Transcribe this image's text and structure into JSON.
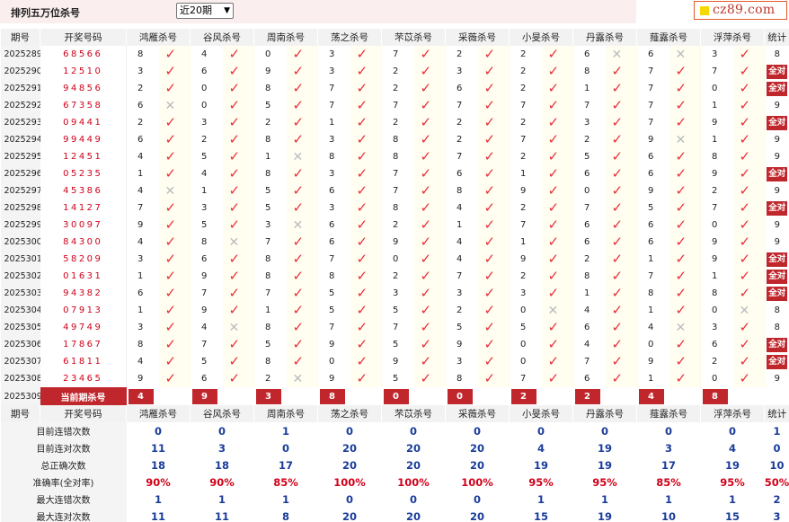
{
  "header": {
    "title": "排列五万位杀号",
    "period_select": "近20期",
    "logo": "cz89.com"
  },
  "columns": {
    "qi": "期号",
    "kj": "开奖号码",
    "experts": [
      "鸿雁杀号",
      "谷风杀号",
      "周南杀号",
      "荡之杀号",
      "芣苡杀号",
      "采薇杀号",
      "小旻杀号",
      "丹露杀号",
      "薤露杀号",
      "浮萍杀号"
    ],
    "tj": "统计"
  },
  "rows": [
    {
      "qi": "2025289",
      "kj": "68566",
      "nums": [
        "8",
        "4",
        "0",
        "3",
        "7",
        "2",
        "2",
        "6",
        "6",
        "3"
      ],
      "ok": [
        1,
        1,
        1,
        1,
        1,
        1,
        1,
        0,
        0,
        1
      ],
      "tj": "8"
    },
    {
      "qi": "2025290",
      "kj": "12510",
      "nums": [
        "3",
        "6",
        "9",
        "3",
        "2",
        "3",
        "2",
        "8",
        "7",
        "7"
      ],
      "ok": [
        1,
        1,
        1,
        1,
        1,
        1,
        1,
        1,
        1,
        1
      ],
      "tj": "全对"
    },
    {
      "qi": "2025291",
      "kj": "94856",
      "nums": [
        "2",
        "0",
        "8",
        "7",
        "2",
        "6",
        "2",
        "1",
        "7",
        "0"
      ],
      "ok": [
        1,
        1,
        1,
        1,
        1,
        1,
        1,
        1,
        1,
        1
      ],
      "tj": "全对"
    },
    {
      "qi": "2025292",
      "kj": "67358",
      "nums": [
        "6",
        "0",
        "5",
        "7",
        "7",
        "7",
        "7",
        "7",
        "7",
        "1"
      ],
      "ok": [
        0,
        1,
        1,
        1,
        1,
        1,
        1,
        1,
        1,
        1
      ],
      "tj": "9"
    },
    {
      "qi": "2025293",
      "kj": "09441",
      "nums": [
        "2",
        "3",
        "2",
        "1",
        "2",
        "2",
        "2",
        "3",
        "7",
        "9"
      ],
      "ok": [
        1,
        1,
        1,
        1,
        1,
        1,
        1,
        1,
        1,
        1
      ],
      "tj": "全对"
    },
    {
      "qi": "2025294",
      "kj": "99449",
      "nums": [
        "6",
        "2",
        "8",
        "3",
        "8",
        "2",
        "7",
        "2",
        "9",
        "1"
      ],
      "ok": [
        1,
        1,
        1,
        1,
        1,
        1,
        1,
        1,
        0,
        1
      ],
      "tj": "9"
    },
    {
      "qi": "2025295",
      "kj": "12451",
      "nums": [
        "4",
        "5",
        "1",
        "8",
        "8",
        "7",
        "2",
        "5",
        "6",
        "8"
      ],
      "ok": [
        1,
        1,
        0,
        1,
        1,
        1,
        1,
        1,
        1,
        1
      ],
      "tj": "9"
    },
    {
      "qi": "2025296",
      "kj": "05235",
      "nums": [
        "1",
        "4",
        "8",
        "3",
        "7",
        "6",
        "1",
        "6",
        "6",
        "9"
      ],
      "ok": [
        1,
        1,
        1,
        1,
        1,
        1,
        1,
        1,
        1,
        1
      ],
      "tj": "全对"
    },
    {
      "qi": "2025297",
      "kj": "45386",
      "nums": [
        "4",
        "1",
        "5",
        "6",
        "7",
        "8",
        "9",
        "0",
        "9",
        "2"
      ],
      "ok": [
        0,
        1,
        1,
        1,
        1,
        1,
        1,
        1,
        1,
        1
      ],
      "tj": "9"
    },
    {
      "qi": "2025298",
      "kj": "14127",
      "nums": [
        "7",
        "3",
        "5",
        "3",
        "8",
        "4",
        "2",
        "7",
        "5",
        "7"
      ],
      "ok": [
        1,
        1,
        1,
        1,
        1,
        1,
        1,
        1,
        1,
        1
      ],
      "tj": "全对"
    },
    {
      "qi": "2025299",
      "kj": "30097",
      "nums": [
        "9",
        "5",
        "3",
        "6",
        "2",
        "1",
        "7",
        "6",
        "6",
        "0"
      ],
      "ok": [
        1,
        1,
        0,
        1,
        1,
        1,
        1,
        1,
        1,
        1
      ],
      "tj": "9"
    },
    {
      "qi": "2025300",
      "kj": "84300",
      "nums": [
        "4",
        "8",
        "7",
        "6",
        "9",
        "4",
        "1",
        "6",
        "6",
        "9"
      ],
      "ok": [
        1,
        0,
        1,
        1,
        1,
        1,
        1,
        1,
        1,
        1
      ],
      "tj": "9"
    },
    {
      "qi": "2025301",
      "kj": "58209",
      "nums": [
        "3",
        "6",
        "8",
        "7",
        "0",
        "4",
        "9",
        "2",
        "1",
        "9"
      ],
      "ok": [
        1,
        1,
        1,
        1,
        1,
        1,
        1,
        1,
        1,
        1
      ],
      "tj": "全对"
    },
    {
      "qi": "2025302",
      "kj": "01631",
      "nums": [
        "1",
        "9",
        "8",
        "8",
        "2",
        "7",
        "2",
        "8",
        "7",
        "1"
      ],
      "ok": [
        1,
        1,
        1,
        1,
        1,
        1,
        1,
        1,
        1,
        1
      ],
      "tj": "全对"
    },
    {
      "qi": "2025303",
      "kj": "94382",
      "nums": [
        "6",
        "7",
        "7",
        "5",
        "3",
        "3",
        "3",
        "1",
        "8",
        "8"
      ],
      "ok": [
        1,
        1,
        1,
        1,
        1,
        1,
        1,
        1,
        1,
        1
      ],
      "tj": "全对"
    },
    {
      "qi": "2025304",
      "kj": "07913",
      "nums": [
        "1",
        "9",
        "1",
        "5",
        "5",
        "2",
        "0",
        "4",
        "1",
        "0"
      ],
      "ok": [
        1,
        1,
        1,
        1,
        1,
        1,
        0,
        1,
        1,
        0
      ],
      "tj": "8"
    },
    {
      "qi": "2025305",
      "kj": "49749",
      "nums": [
        "3",
        "4",
        "8",
        "7",
        "7",
        "5",
        "5",
        "6",
        "4",
        "3"
      ],
      "ok": [
        1,
        0,
        1,
        1,
        1,
        1,
        1,
        1,
        0,
        1
      ],
      "tj": "8"
    },
    {
      "qi": "2025306",
      "kj": "17867",
      "nums": [
        "8",
        "7",
        "5",
        "9",
        "5",
        "9",
        "0",
        "4",
        "0",
        "6"
      ],
      "ok": [
        1,
        1,
        1,
        1,
        1,
        1,
        1,
        1,
        1,
        1
      ],
      "tj": "全对"
    },
    {
      "qi": "2025307",
      "kj": "61811",
      "nums": [
        "4",
        "5",
        "8",
        "0",
        "9",
        "3",
        "0",
        "7",
        "9",
        "2"
      ],
      "ok": [
        1,
        1,
        1,
        1,
        1,
        1,
        1,
        1,
        1,
        1
      ],
      "tj": "全对"
    },
    {
      "qi": "2025308",
      "kj": "23465",
      "nums": [
        "9",
        "6",
        "2",
        "9",
        "5",
        "8",
        "7",
        "6",
        "1",
        "0"
      ],
      "ok": [
        1,
        1,
        0,
        1,
        1,
        1,
        1,
        1,
        1,
        1
      ],
      "tj": "9"
    }
  ],
  "current": {
    "qi": "2025309",
    "label": "当前期杀号",
    "values": [
      "4",
      "9",
      "3",
      "8",
      "0",
      "0",
      "2",
      "2",
      "4",
      "8"
    ]
  },
  "stats": [
    {
      "label": "目前连错次数",
      "values": [
        "0",
        "0",
        "1",
        "0",
        "0",
        "0",
        "0",
        "0",
        "0",
        "0",
        "1"
      ],
      "red": false
    },
    {
      "label": "目前连对次数",
      "values": [
        "11",
        "3",
        "0",
        "20",
        "20",
        "20",
        "4",
        "19",
        "3",
        "4",
        "0"
      ],
      "red": false
    },
    {
      "label": "总正确次数",
      "values": [
        "18",
        "18",
        "17",
        "20",
        "20",
        "20",
        "19",
        "19",
        "17",
        "19",
        "10"
      ],
      "red": false
    },
    {
      "label": "准确率(全对率)",
      "values": [
        "90%",
        "90%",
        "85%",
        "100%",
        "100%",
        "100%",
        "95%",
        "95%",
        "85%",
        "95%",
        "50%"
      ],
      "red": true
    },
    {
      "label": "最大连错次数",
      "values": [
        "1",
        "1",
        "1",
        "0",
        "0",
        "0",
        "1",
        "1",
        "1",
        "1",
        "2"
      ],
      "red": false
    },
    {
      "label": "最大连对次数",
      "values": [
        "11",
        "11",
        "8",
        "20",
        "20",
        "20",
        "15",
        "19",
        "10",
        "15",
        "3"
      ],
      "red": false
    }
  ],
  "marks": {
    "ok": "✓",
    "no": "✕"
  },
  "colors": {
    "accent": "#c0272d",
    "number_red": "#d0021b",
    "stat_blue": "#1a3c9a",
    "check": "#ea2e37",
    "cross": "#b9bcc0",
    "header_bg": "#fbeeee"
  }
}
